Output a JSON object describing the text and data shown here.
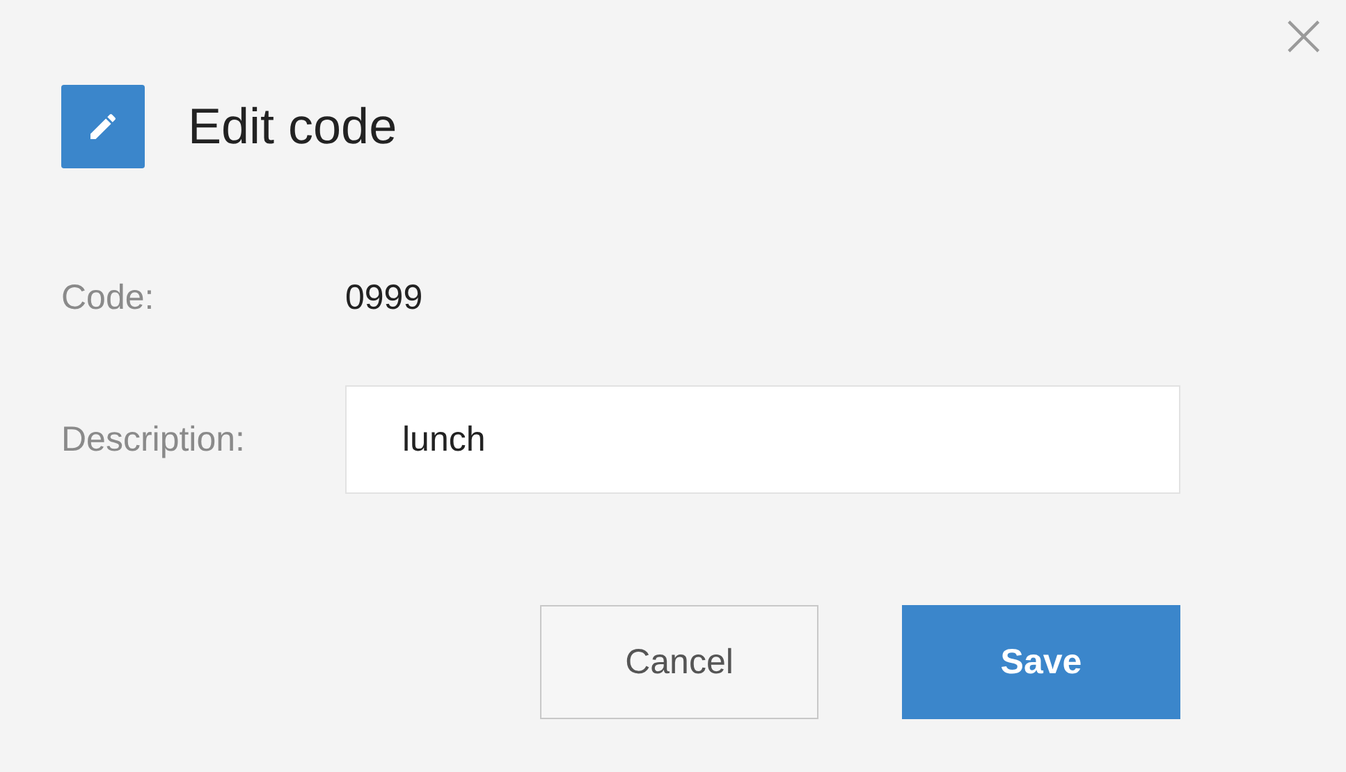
{
  "dialog": {
    "title": "Edit code",
    "close": "×"
  },
  "fields": [
    {
      "kind": "text",
      "label": "Code:",
      "value": "0999"
    },
    {
      "kind": "input",
      "label": "Description:",
      "value": "lunch"
    }
  ],
  "buttons": [
    {
      "label": "Cancel",
      "kind": "secondary"
    },
    {
      "label": "Save",
      "kind": "primary"
    }
  ]
}
